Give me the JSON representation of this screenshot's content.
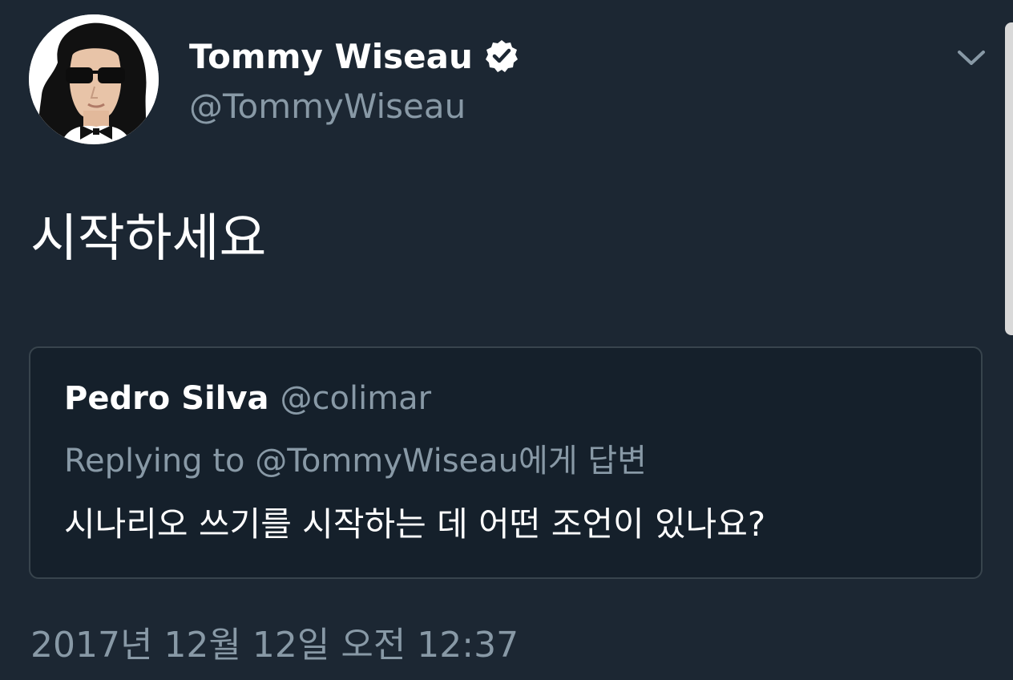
{
  "author": {
    "display_name": "Tommy Wiseau",
    "handle": "@TommyWiseau",
    "verified_icon": "verified-badge-icon",
    "avatar": "avatar-illustration"
  },
  "menu": {
    "icon": "chevron-down-icon"
  },
  "tweet": {
    "text": "시작하세요"
  },
  "quoted_tweet": {
    "display_name": "Pedro Silva",
    "handle": "@colimar",
    "replying_to": "Replying to @TommyWiseau에게 답변",
    "text": "시나리오 쓰기를 시작하는 데 어떤 조언이 있나요?"
  },
  "timestamp": "2017년 12월 12일 오전 12:37",
  "colors": {
    "background": "#1c2733",
    "card_background": "#15202b",
    "card_border": "#38444d",
    "secondary_text": "#8899a6",
    "primary_text": "#ffffff"
  }
}
